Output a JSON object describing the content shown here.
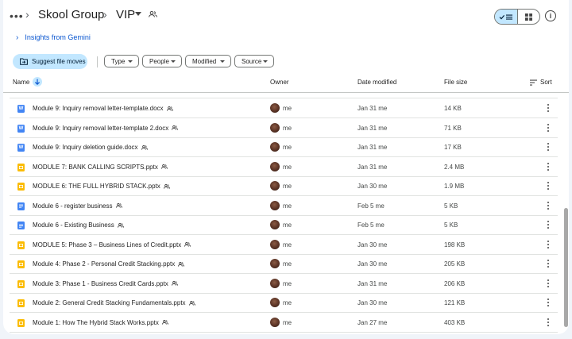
{
  "breadcrumb": {
    "more": "•••",
    "parent": "Skool Group",
    "current": "VIP"
  },
  "gemini": {
    "label": "Insights from Gemini"
  },
  "filters": {
    "suggest_label": "Suggest file moves",
    "chips": [
      "Type",
      "People",
      "Modified",
      "Source"
    ]
  },
  "table": {
    "headers": {
      "name": "Name",
      "owner": "Owner",
      "date": "Date modified",
      "size": "File size",
      "sort": "Sort"
    },
    "rows": [
      {
        "name": "Module 9: Inquiry removal letter-template.docx",
        "type": "word",
        "owner": "me",
        "date": "Jan 31 me",
        "size": "14 KB"
      },
      {
        "name": "Module 9: Inquiry removal letter-template 2.docx",
        "type": "word",
        "owner": "me",
        "date": "Jan 31 me",
        "size": "71 KB"
      },
      {
        "name": "Module 9: Inquiry deletion guide.docx",
        "type": "word",
        "owner": "me",
        "date": "Jan 31 me",
        "size": "17 KB"
      },
      {
        "name": "MODULE 7: BANK CALLING SCRIPTS.pptx",
        "type": "slides",
        "owner": "me",
        "date": "Jan 31 me",
        "size": "2.4 MB"
      },
      {
        "name": "MODULE 6: THE FULL HYBRID STACK.pptx",
        "type": "slides",
        "owner": "me",
        "date": "Jan 30 me",
        "size": "1.9 MB"
      },
      {
        "name": "Module 6 -  register business",
        "type": "docs",
        "owner": "me",
        "date": "Feb 5 me",
        "size": "5 KB"
      },
      {
        "name": "Module 6 -  Existing Business",
        "type": "docs",
        "owner": "me",
        "date": "Feb 5 me",
        "size": "5 KB"
      },
      {
        "name": "MODULE 5: Phase 3 – Business Lines of Credit.pptx",
        "type": "slides",
        "owner": "me",
        "date": "Jan 30 me",
        "size": "198 KB"
      },
      {
        "name": "Module 4: Phase 2 - Personal Credit Stacking.pptx",
        "type": "slides",
        "owner": "me",
        "date": "Jan 30 me",
        "size": "205 KB"
      },
      {
        "name": "Module 3: Phase 1 - Business Credit Cards.pptx",
        "type": "slides",
        "owner": "me",
        "date": "Jan 31 me",
        "size": "206 KB"
      },
      {
        "name": "Module 2: General Credit Stacking Fundamentals.pptx",
        "type": "slides",
        "owner": "me",
        "date": "Jan 30 me",
        "size": "121 KB"
      },
      {
        "name": "Module 1: How The Hybrid Stack Works.pptx",
        "type": "slides",
        "owner": "me",
        "date": "Jan 27 me",
        "size": "403 KB"
      }
    ]
  },
  "colors": {
    "word": "#4285f4",
    "slides": "#fbbc04",
    "docs": "#4285f4",
    "accent": "#0b57d0",
    "selected": "#c2e7ff"
  },
  "icons": {
    "word_letter": "W"
  }
}
